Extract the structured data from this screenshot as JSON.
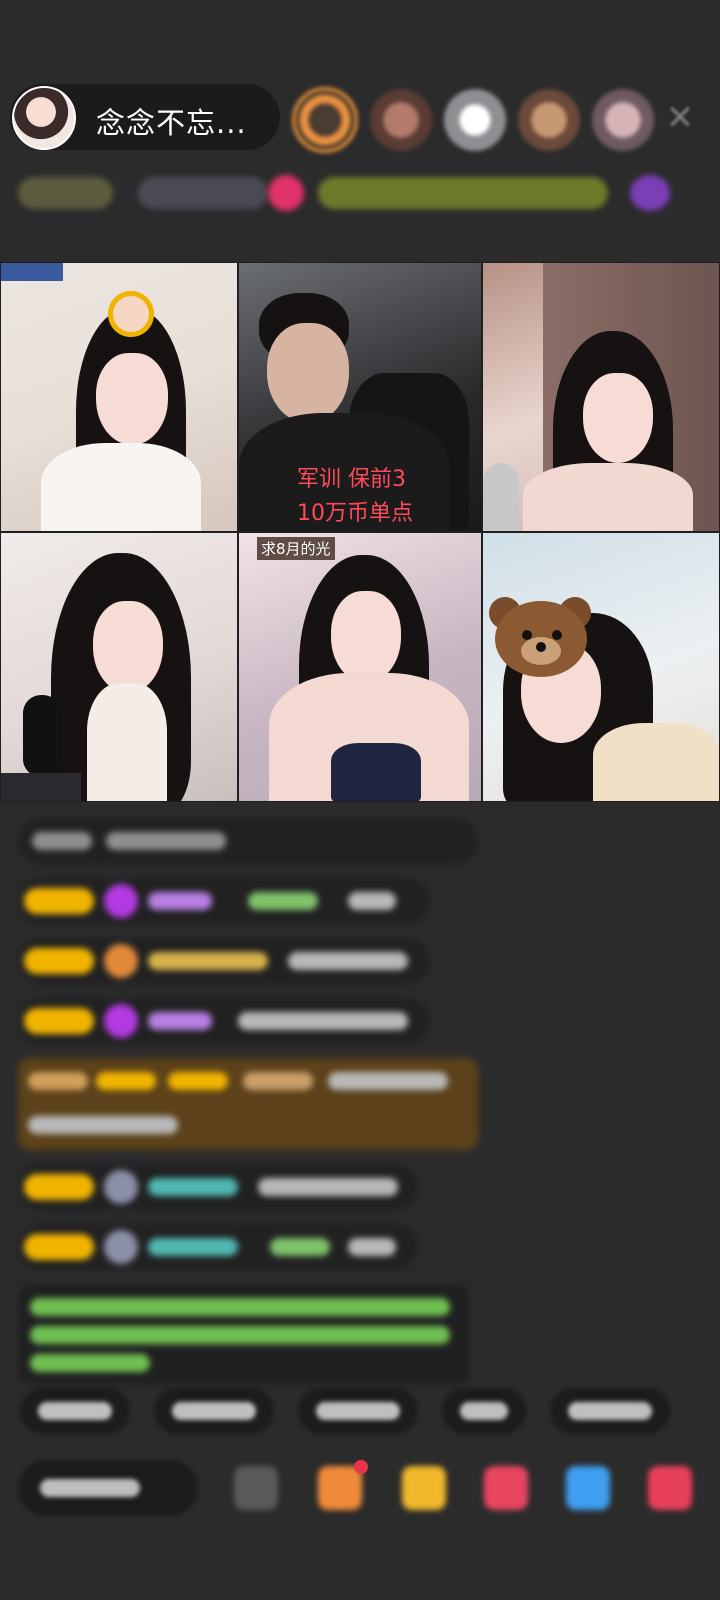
{
  "header": {
    "host_name": "念念不忘...",
    "close_icon": "close-icon"
  },
  "video": {
    "overlay_text": "军训 保前3\n10万币单点",
    "tag_text": "求8月的光"
  },
  "colors": {
    "background": "#2b2b2c",
    "badge": "#f0b400",
    "overlay_text": "#ff4a5a"
  }
}
